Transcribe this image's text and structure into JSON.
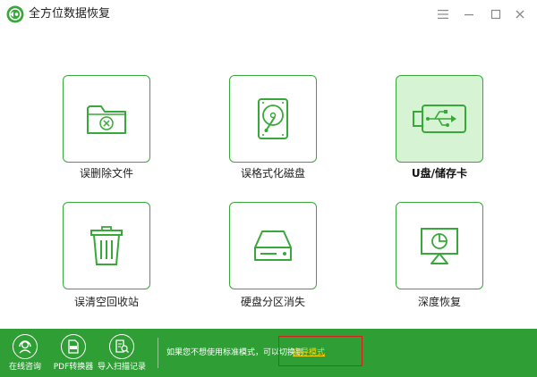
{
  "window": {
    "title": "全方位数据恢复",
    "logo_icon": "recovery-logo-icon",
    "controls": [
      "menu-icon",
      "minimize-icon",
      "maximize-icon",
      "close-icon"
    ]
  },
  "colors": {
    "accent": "#39a83a",
    "footer_bg": "#2e9e35",
    "selected_tile_bg": "#d6f3d3",
    "link": "#ffd400",
    "highlight_box": "#d41f1f"
  },
  "tiles": [
    {
      "label": "误删除文件",
      "icon": "deleted-folder-icon",
      "selected": false
    },
    {
      "label": "误格式化磁盘",
      "icon": "hard-disk-icon",
      "selected": false
    },
    {
      "label": "U盘/储存卡",
      "icon": "usb-drive-icon",
      "selected": true
    },
    {
      "label": "误清空回收站",
      "icon": "recycle-bin-icon",
      "selected": false
    },
    {
      "label": "硬盘分区消失",
      "icon": "drive-partition-icon",
      "selected": false
    },
    {
      "label": "深度恢复",
      "icon": "deep-recovery-icon",
      "selected": false
    }
  ],
  "footer": {
    "items": [
      {
        "label": "在线咨询",
        "icon": "headset-icon"
      },
      {
        "label": "PDF转换器",
        "icon": "pdf-icon"
      },
      {
        "label": "导入扫描记录",
        "icon": "import-record-icon"
      }
    ],
    "hint": "如果您不想使用标准模式，可以切换到",
    "link_label": "向导模式"
  }
}
